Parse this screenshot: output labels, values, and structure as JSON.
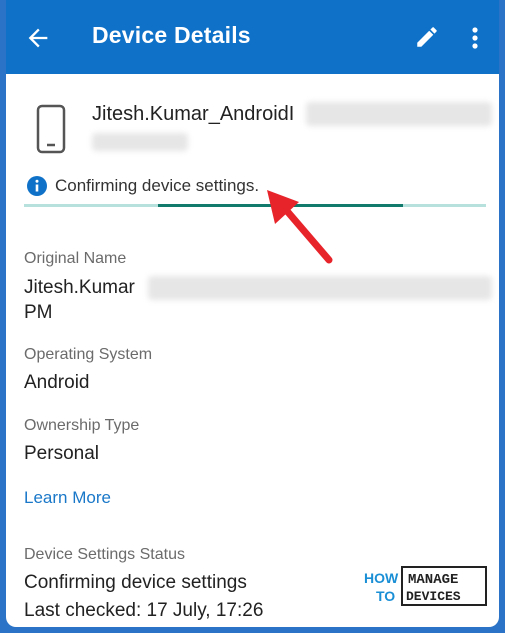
{
  "header": {
    "title": "Device Details",
    "back_icon": "arrow-left-icon",
    "edit_icon": "pencil-icon",
    "more_icon": "more-vertical-icon"
  },
  "device": {
    "icon": "phone-icon",
    "name": "Jitesh.Kumar_AndroidI"
  },
  "status_banner": {
    "icon": "info-icon",
    "text": "Confirming device settings.",
    "progress_visible_segment": [
      0.29,
      0.82
    ]
  },
  "details": [
    {
      "label": "Original Name",
      "value_line1": "Jitesh.Kumar",
      "value_line2": "PM"
    },
    {
      "label": "Operating System",
      "value": "Android"
    },
    {
      "label": "Ownership Type",
      "value": "Personal"
    }
  ],
  "learn_more": "Learn More",
  "settings_status": {
    "label": "Device Settings Status",
    "status": "Confirming device settings",
    "last_checked": "Last checked: 17 July, 17:26"
  },
  "watermark": {
    "how": "HOW",
    "to": "TO",
    "manage": "MANAGE",
    "devices": "DEVICES"
  },
  "colors": {
    "appbar": "#0f72c8",
    "progress": "#117a6d",
    "progress_track": "#b7e1dc",
    "link": "#1a78c9",
    "annotation_arrow": "#e8242b"
  }
}
